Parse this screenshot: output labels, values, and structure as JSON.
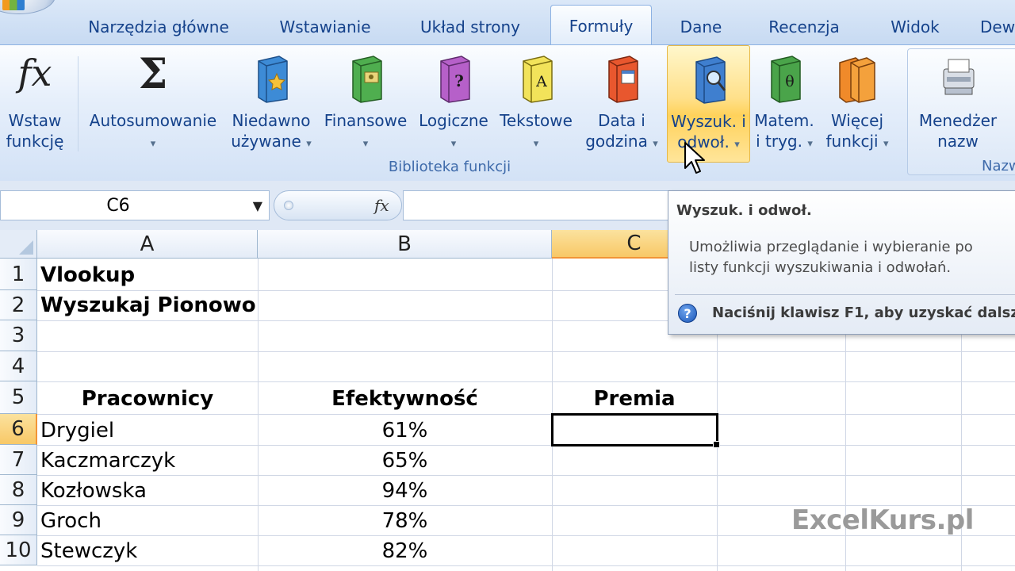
{
  "tabs": [
    {
      "label": "Narzędzia główne",
      "active": false
    },
    {
      "label": "Wstawianie",
      "active": false
    },
    {
      "label": "Układ strony",
      "active": false
    },
    {
      "label": "Formuły",
      "active": true
    },
    {
      "label": "Dane",
      "active": false
    },
    {
      "label": "Recenzja",
      "active": false
    },
    {
      "label": "Widok",
      "active": false
    },
    {
      "label": "Dew",
      "active": false
    }
  ],
  "ribbon": {
    "buttons": [
      {
        "line1": "Wstaw",
        "line2": "funkcję",
        "icon": "fx-icon"
      },
      {
        "line1": "Autosumowanie",
        "line2": "▾",
        "icon": "sigma-icon"
      },
      {
        "line1": "Niedawno",
        "line2": "używane",
        "icon": "book-star-icon"
      },
      {
        "line1": "Finansowe",
        "line2": "▾",
        "icon": "book-money-icon"
      },
      {
        "line1": "Logiczne",
        "line2": "▾",
        "icon": "book-question-icon"
      },
      {
        "line1": "Tekstowe",
        "line2": "▾",
        "icon": "book-text-icon"
      },
      {
        "line1": "Data i",
        "line2": "godzina",
        "icon": "book-calendar-icon"
      },
      {
        "line1": "Wyszuk. i",
        "line2": "odwoł.",
        "icon": "book-magnifier-icon"
      },
      {
        "line1": "Matem.",
        "line2": "i tryg.",
        "icon": "book-theta-icon"
      },
      {
        "line1": "Więcej",
        "line2": "funkcji",
        "icon": "books-icon"
      },
      {
        "line1": "Menedżer",
        "line2": "nazw",
        "icon": "name-manager-icon"
      }
    ],
    "group_label": "Biblioteka funkcji",
    "group2_label": "Nazw"
  },
  "formula_bar": {
    "name_box": "C6",
    "fx": "fx",
    "value": ""
  },
  "columns": [
    "A",
    "B",
    "C"
  ],
  "rows": [
    "1",
    "2",
    "3",
    "4",
    "5",
    "6",
    "7",
    "8",
    "9",
    "10"
  ],
  "cells": {
    "a1": "Vlookup",
    "a2": "Wyszukaj Pionowo",
    "headers": {
      "a": "Pracownicy",
      "b": "Efektywność",
      "c": "Premia"
    },
    "data": [
      {
        "name": "Drygiel",
        "value": "61%"
      },
      {
        "name": "Kaczmarczyk",
        "value": "65%"
      },
      {
        "name": "Kozłowska",
        "value": "94%"
      },
      {
        "name": "Groch",
        "value": "78%"
      },
      {
        "name": "Stewczyk",
        "value": "82%"
      }
    ]
  },
  "tooltip": {
    "title": "Wyszuk. i odwoł.",
    "line1": "Umożliwia przeglądanie i wybieranie po",
    "line2": "listy funkcji wyszukiwania i odwołań.",
    "help": "Naciśnij klawisz F1, aby uzyskać dalsz"
  },
  "watermark": "ExcelKurs.pl",
  "colors": {
    "accent": "#15428b",
    "selected_header": "#f8c867",
    "hot_button": "#ffd25b"
  }
}
